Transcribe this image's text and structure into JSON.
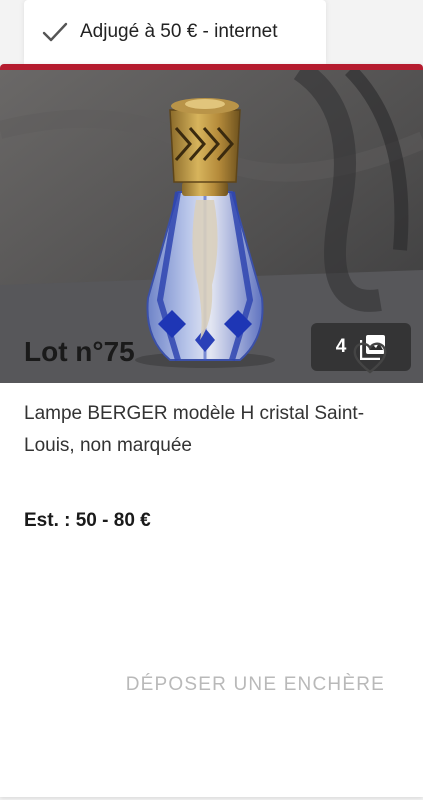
{
  "status_tab": {
    "label": "Adjugé à 50 € - internet"
  },
  "lot": {
    "title": "Lot n°75",
    "description": "Lampe BERGER modèle H cristal Saint-Louis, non marquée",
    "estimate": "Est. : 50 - 80 €",
    "photo_count": "4",
    "bid_label": "DÉPOSER UNE ENCHÈRE"
  },
  "colors": {
    "accent": "#b51c2f",
    "disabled_text": "#b9b9b9"
  },
  "icons": {
    "status": "check-icon",
    "gallery": "gallery-icon",
    "favorite": "heart-outline-icon"
  }
}
